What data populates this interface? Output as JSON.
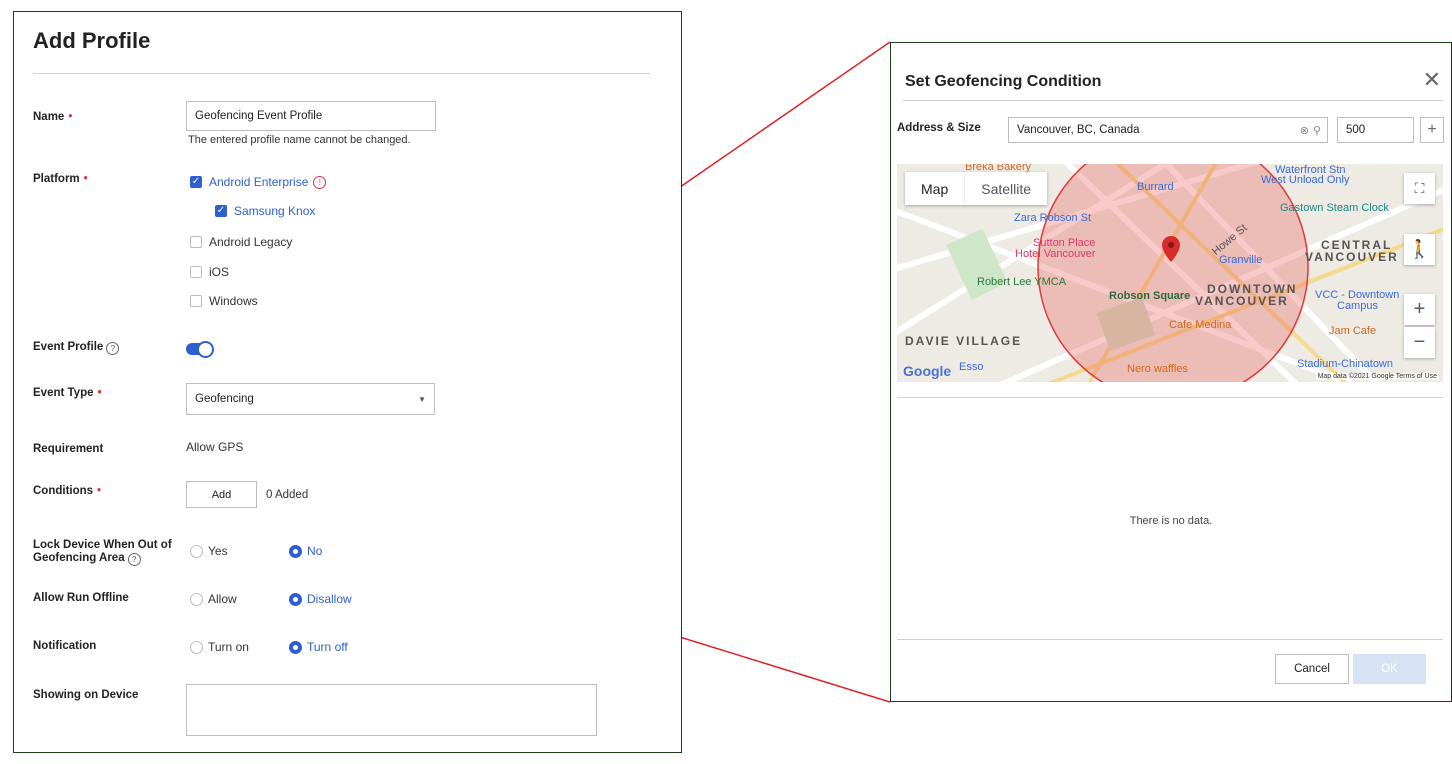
{
  "left": {
    "title": "Add Profile",
    "name_label": "Name",
    "name_value": "Geofencing Event Profile",
    "name_hint": "The entered profile name cannot be changed.",
    "platform_label": "Platform",
    "platforms": [
      {
        "label": "Android Enterprise",
        "checked": true
      },
      {
        "label": "Samsung Knox",
        "checked": true
      },
      {
        "label": "Android Legacy",
        "checked": false
      },
      {
        "label": "iOS",
        "checked": false
      },
      {
        "label": "Windows",
        "checked": false
      }
    ],
    "event_profile_label": "Event Profile",
    "event_profile_on": true,
    "event_type_label": "Event Type",
    "event_type_value": "Geofencing",
    "requirement_label": "Requirement",
    "requirement_value": "Allow GPS",
    "conditions_label": "Conditions",
    "add_button": "Add",
    "added_count": "0 Added",
    "lock_label_1": "Lock Device When Out of",
    "lock_label_2": "Geofencing Area",
    "lock_options": {
      "yes": "Yes",
      "no": "No",
      "selected": "No"
    },
    "offline_label": "Allow Run Offline",
    "offline_options": {
      "allow": "Allow",
      "disallow": "Disallow",
      "selected": "Disallow"
    },
    "notification_label": "Notification",
    "notification_options": {
      "on": "Turn on",
      "off": "Turn off",
      "selected": "Turn off"
    },
    "showing_label": "Showing on Device",
    "showing_value": ""
  },
  "dialog": {
    "title": "Set Geofencing Condition",
    "address_label": "Address & Size",
    "address_value": "Vancouver, BC, Canada",
    "size_value": "500",
    "map": {
      "tab_map": "Map",
      "tab_satellite": "Satellite",
      "labels": {
        "breka": "Breka Bakery",
        "burrard": "Burrard",
        "waterfront": "Waterfront Stn",
        "west_unload": "West Unload Only",
        "zara": "Zara Robson St",
        "gastown": "Gastown Steam Clock",
        "central": "CENTRAL",
        "vancouver": "VANCOUVER",
        "sutton1": "Sutton Place",
        "sutton2": "Hotel Vancouver",
        "granville": "Granville",
        "howe": "Howe St",
        "robert_lee": "Robert Lee YMCA",
        "robson_square": "Robson Square",
        "downtown1": "DOWNTOWN",
        "downtown2": "VANCOUVER",
        "vcc1": "VCC - Downtown",
        "vcc2": "Campus",
        "cafe_medina": "Cafe Medina",
        "jam_cafe": "Jam Cafe",
        "davie": "DAVIE VILLAGE",
        "esso": "Esso",
        "nero": "Nero waffles",
        "stadium": "Stadium-Chinatown",
        "google": "Google",
        "footer": "Map data ©2021 Google   Terms of Use"
      }
    },
    "empty_text": "There is no data.",
    "cancel": "Cancel",
    "ok": "OK"
  },
  "colors": {
    "accent": "#2d5fd0",
    "required": "#e0334b",
    "panel_border": "#1f3d1a",
    "connector": "#e02020"
  }
}
